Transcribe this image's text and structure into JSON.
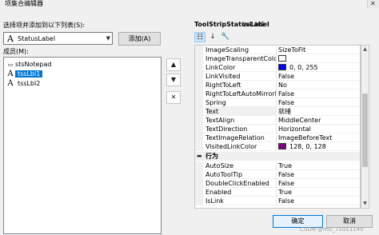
{
  "window": {
    "title": "项集合编辑器"
  },
  "select_label": "选择项并添加到以下列表(S):",
  "combo": {
    "icon": "label-icon",
    "value": "StatusLabel"
  },
  "add_button": "添加(A)",
  "members_label": "成员(M):",
  "members": [
    {
      "icon": "statusstrip-icon",
      "label": "stsNotepad"
    },
    {
      "icon": "label-icon",
      "label": "tssLbl1",
      "selected": true
    },
    {
      "icon": "label-icon",
      "label": "tssLbl2"
    }
  ],
  "side_buttons": {
    "up": "▲",
    "down": "▼",
    "delete": "✕"
  },
  "properties": {
    "type": "ToolStripStatusLabel",
    "name": "tssLbl1",
    "toolbar": [
      "categorized-icon",
      "alphabetical-icon",
      "property-pages-icon"
    ],
    "rows": [
      {
        "name": "ImageScaling",
        "value": "SizeToFit"
      },
      {
        "name": "ImageTransparentColor",
        "value": "",
        "swatch": "#ffffff"
      },
      {
        "name": "LinkColor",
        "value": "0, 0, 255",
        "swatch": "#0000ff"
      },
      {
        "name": "LinkVisited",
        "value": "False"
      },
      {
        "name": "RightToLeft",
        "value": "No"
      },
      {
        "name": "RightToLeftAutoMirrorImage",
        "value": "False"
      },
      {
        "name": "Spring",
        "value": "False"
      },
      {
        "name": "Text",
        "value": "就绪",
        "selected": true
      },
      {
        "name": "TextAlign",
        "value": "MiddleCenter"
      },
      {
        "name": "TextDirection",
        "value": "Horizontal"
      },
      {
        "name": "TextImageRelation",
        "value": "ImageBeforeText"
      },
      {
        "name": "VisitedLinkColor",
        "value": "128, 0, 128",
        "swatch": "#800080"
      },
      {
        "category": true,
        "name": "行为"
      },
      {
        "name": "AutoSize",
        "value": "True"
      },
      {
        "name": "AutoToolTip",
        "value": "False"
      },
      {
        "name": "DoubleClickEnabled",
        "value": "False"
      },
      {
        "name": "Enabled",
        "value": "True"
      },
      {
        "name": "IsLink",
        "value": "False"
      }
    ]
  },
  "ok_button": "确定",
  "cancel_button": "取消",
  "watermark": "CSDN @m0_71011140"
}
